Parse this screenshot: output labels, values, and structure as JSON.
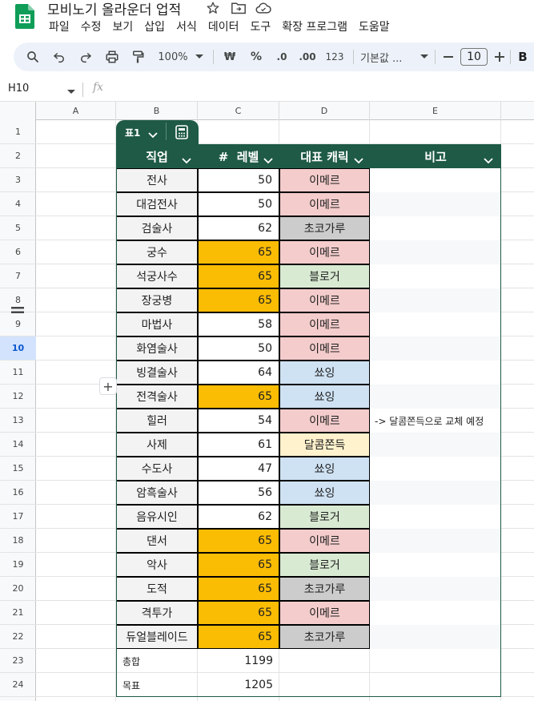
{
  "app": {
    "title": "모비노기 올라운더 업적",
    "menu": [
      "파일",
      "수정",
      "보기",
      "삽입",
      "서식",
      "데이터",
      "도구",
      "확장 프로그램",
      "도움말"
    ]
  },
  "toolbar": {
    "zoom": "100%",
    "currency": "₩",
    "percent": "%",
    "decimal_decrease": ".0",
    "decimal_increase": ".00",
    "number_format": "123",
    "font_family": "기본값 ...",
    "font_size": "10",
    "bold": "B"
  },
  "formula_bar": {
    "cell_ref": "H10",
    "fx": "fx"
  },
  "columns": [
    "A",
    "B",
    "C",
    "D",
    "E"
  ],
  "rows": [
    "1",
    "2",
    "3",
    "4",
    "5",
    "6",
    "7",
    "8",
    "9",
    "10",
    "11",
    "12",
    "13",
    "14",
    "15",
    "16",
    "17",
    "18",
    "19",
    "20",
    "21",
    "22",
    "23",
    "24"
  ],
  "active_row": "10",
  "table": {
    "name": "표1",
    "headers": [
      "직업",
      "#  레벨",
      "대표 캐릭",
      "비고"
    ],
    "rows": [
      {
        "job": "전사",
        "level": "50",
        "char": "이메르",
        "note": ""
      },
      {
        "job": "대검전사",
        "level": "50",
        "char": "이메르",
        "note": ""
      },
      {
        "job": "검술사",
        "level": "62",
        "char": "초코가루",
        "note": ""
      },
      {
        "job": "궁수",
        "level": "65",
        "char": "이메르",
        "note": ""
      },
      {
        "job": "석궁사수",
        "level": "65",
        "char": "블로거",
        "note": ""
      },
      {
        "job": "장궁병",
        "level": "65",
        "char": "이메르",
        "note": ""
      },
      {
        "job": "마법사",
        "level": "58",
        "char": "이메르",
        "note": ""
      },
      {
        "job": "화염술사",
        "level": "50",
        "char": "이메르",
        "note": ""
      },
      {
        "job": "빙결술사",
        "level": "64",
        "char": "쑈잉",
        "note": ""
      },
      {
        "job": "전격술사",
        "level": "65",
        "char": "쑈잉",
        "note": ""
      },
      {
        "job": "힐러",
        "level": "54",
        "char": "이메르",
        "note": "-> 달콤쫀득으로 교체 예정"
      },
      {
        "job": "사제",
        "level": "61",
        "char": "달콤쫀득",
        "note": ""
      },
      {
        "job": "수도사",
        "level": "47",
        "char": "쑈잉",
        "note": ""
      },
      {
        "job": "암흑술사",
        "level": "56",
        "char": "쑈잉",
        "note": ""
      },
      {
        "job": "음유시인",
        "level": "62",
        "char": "블로거",
        "note": ""
      },
      {
        "job": "댄서",
        "level": "65",
        "char": "이메르",
        "note": ""
      },
      {
        "job": "악사",
        "level": "65",
        "char": "블로거",
        "note": ""
      },
      {
        "job": "도적",
        "level": "65",
        "char": "초코가루",
        "note": ""
      },
      {
        "job": "격투가",
        "level": "65",
        "char": "이메르",
        "note": ""
      },
      {
        "job": "듀얼블레이드",
        "level": "65",
        "char": "초코가루",
        "note": ""
      }
    ],
    "summary": [
      {
        "label": "총합",
        "value": "1199"
      },
      {
        "label": "목표",
        "value": "1205"
      }
    ]
  },
  "colors": {
    "table_header": "#1e5a45",
    "max_level": "#fbbc04",
    "imer": "#f4cccc",
    "blogger": "#d9ead3",
    "choco": "#cccccc",
    "showing": "#cfe2f3",
    "dalkom": "#fff2cc"
  }
}
